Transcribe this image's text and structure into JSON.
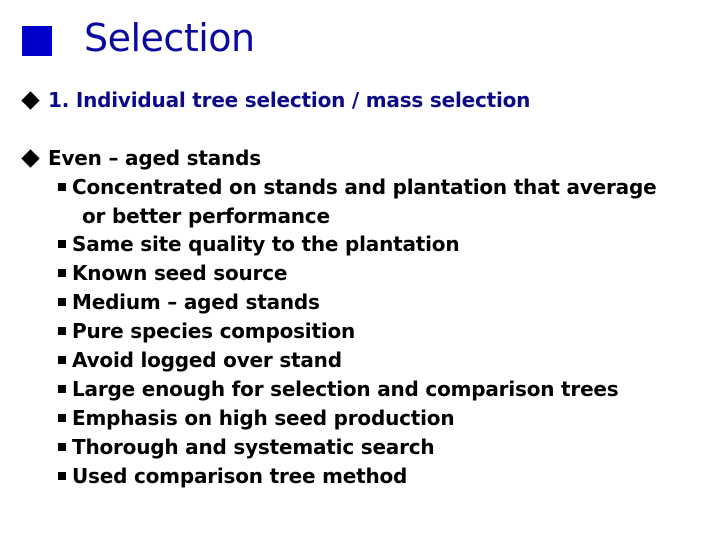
{
  "slide": {
    "title": "Selection",
    "accent_color": "#0000cc",
    "bullets": [
      {
        "text": "1. Individual tree selection / mass selection",
        "color": "#0a0a8a"
      },
      {
        "text": "Even – aged stands",
        "color": "#000000"
      }
    ],
    "sub_bullets": [
      {
        "text": "Concentrated on stands and plantation that average",
        "continuation": "or better performance"
      },
      {
        "text": "Same site quality to the plantation"
      },
      {
        "text": "Known seed source"
      },
      {
        "text": "Medium – aged stands"
      },
      {
        "text": "Pure species composition"
      },
      {
        "text": "Avoid logged over stand"
      },
      {
        "text": "Large enough for selection and comparison trees"
      },
      {
        "text": "Emphasis on high seed production"
      },
      {
        "text": "Thorough and systematic search"
      },
      {
        "text": "Used comparison tree method"
      }
    ]
  }
}
